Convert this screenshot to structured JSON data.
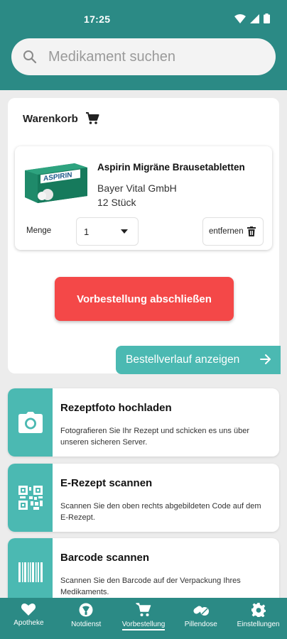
{
  "status": {
    "time": "17:25"
  },
  "search": {
    "placeholder": "Medikament suchen"
  },
  "cart": {
    "title": "Warenkorb",
    "item": {
      "image_text": "ASPIRIN",
      "name": "Aspirin Migräne Brausetabletten",
      "manufacturer": "Bayer Vital GmbH",
      "package": "12 Stück",
      "quantity_label": "Menge",
      "quantity_value": "1",
      "remove_label": "entfernen"
    },
    "order_button": "Vorbestellung abschließen",
    "history_button": "Bestellverlauf anzeigen"
  },
  "actions": [
    {
      "title": "Rezeptfoto hochladen",
      "desc": "Fotografieren Sie Ihr Rezept und schicken es uns über unseren sicheren Server.",
      "icon": "camera-icon"
    },
    {
      "title": "E-Rezept scannen",
      "desc": "Scannen Sie den oben rechts abgebildeten Code auf dem E-Rezept.",
      "icon": "qr-code-icon"
    },
    {
      "title": "Barcode scannen",
      "desc": "Scannen Sie den Barcode auf der Verpackung Ihres Medikaments.",
      "icon": "barcode-icon"
    }
  ],
  "nav": [
    {
      "label": "Apotheke",
      "icon": "heart-icon"
    },
    {
      "label": "Notdienst",
      "icon": "emergency-icon"
    },
    {
      "label": "Vorbestellung",
      "icon": "cart-icon",
      "active": true
    },
    {
      "label": "Pillendose",
      "icon": "pills-icon"
    },
    {
      "label": "Einstellungen",
      "icon": "gear-icon"
    }
  ],
  "colors": {
    "primary": "#2b8a85",
    "accent": "#4bb9b2",
    "danger": "#f44848"
  }
}
